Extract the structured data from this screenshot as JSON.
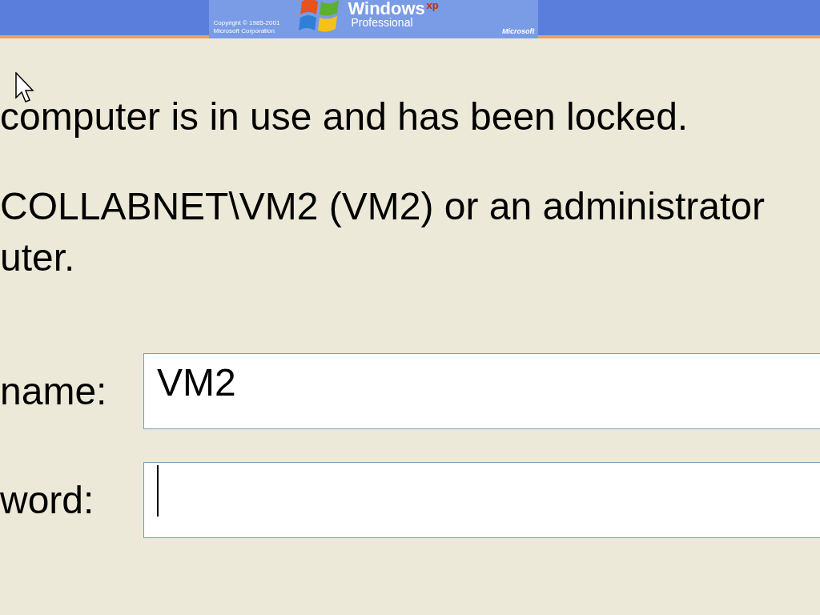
{
  "banner": {
    "copyright": "Copyright © 1985-2001",
    "company": "Microsoft Corporation",
    "product": "Windows",
    "edition_mark": "xp",
    "edition": "Professional",
    "brand": "Microsoft"
  },
  "message": {
    "lines": [
      "computer is in use and has been locked.",
      "COLLABNET\\VM2 (VM2) or an administrator",
      "uter."
    ]
  },
  "fields": [
    {
      "label": "name:",
      "value": "VM2",
      "focused": false
    },
    {
      "label": "word:",
      "focused": true
    }
  ]
}
